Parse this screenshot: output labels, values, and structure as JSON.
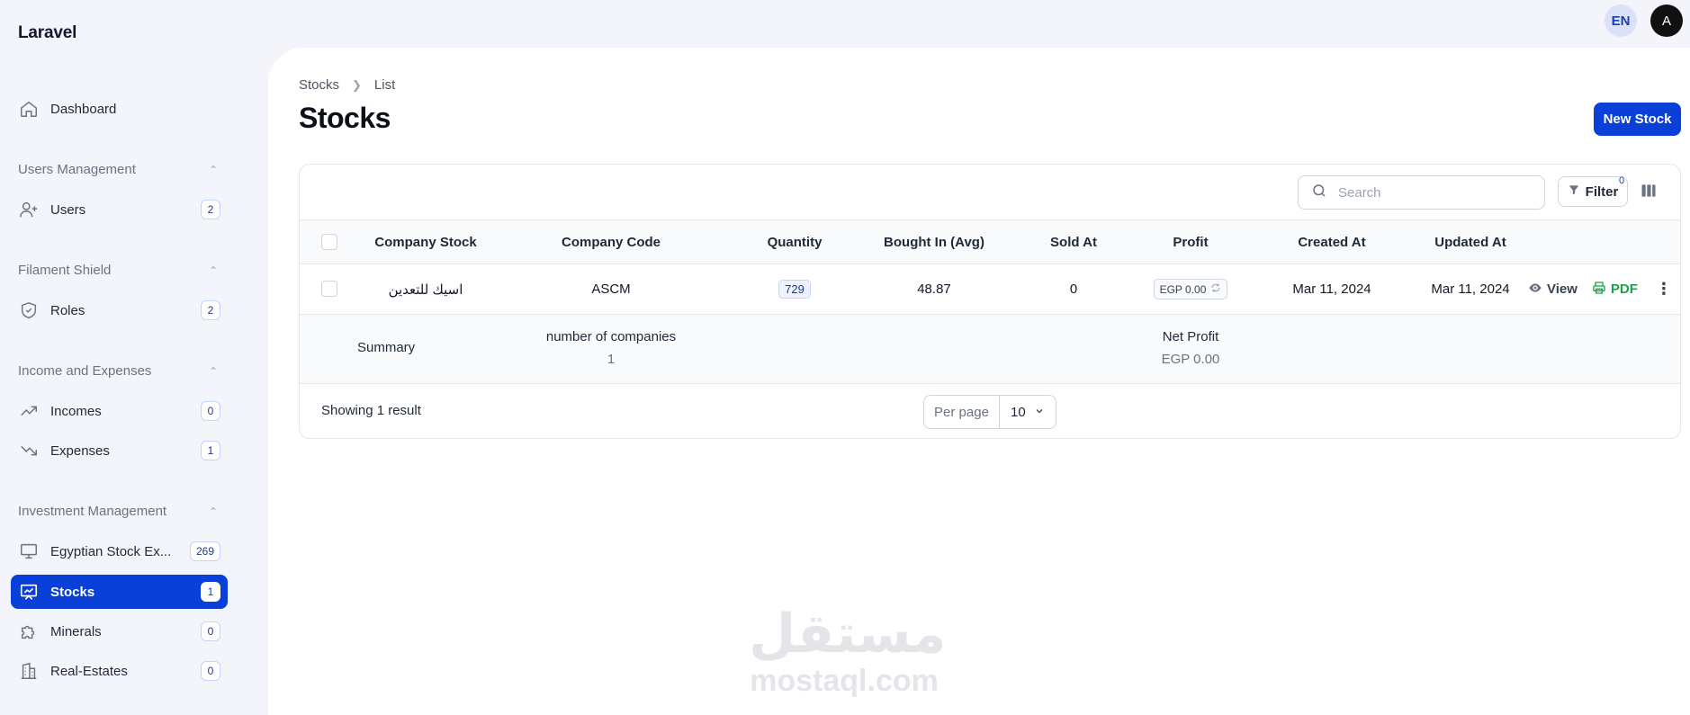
{
  "brand": "Laravel",
  "topbar": {
    "lang": "EN",
    "user_initial": "A"
  },
  "sidebar": {
    "dashboard": "Dashboard",
    "groups": [
      {
        "title": "Users Management",
        "items": [
          {
            "label": "Users",
            "count": "2"
          }
        ]
      },
      {
        "title": "Filament Shield",
        "items": [
          {
            "label": "Roles",
            "count": "2"
          }
        ]
      },
      {
        "title": "Income and Expenses",
        "items": [
          {
            "label": "Incomes",
            "count": "0"
          },
          {
            "label": "Expenses",
            "count": "1"
          }
        ]
      },
      {
        "title": "Investment Management",
        "items": [
          {
            "label": "Egyptian Stock Ex...",
            "count": "269"
          },
          {
            "label": "Stocks",
            "count": "1"
          },
          {
            "label": "Minerals",
            "count": "0"
          },
          {
            "label": "Real-Estates",
            "count": "0"
          }
        ]
      }
    ]
  },
  "breadcrumb": {
    "parent": "Stocks",
    "current": "List"
  },
  "page": {
    "title": "Stocks",
    "new_button": "New Stock"
  },
  "toolbar": {
    "search_placeholder": "Search",
    "filter_label": "Filter",
    "filter_count": "0"
  },
  "table": {
    "columns": {
      "company_stock": "Company Stock",
      "company_code": "Company Code",
      "quantity": "Quantity",
      "bought_in": "Bought In (Avg)",
      "sold_at": "Sold At",
      "profit": "Profit",
      "created_at": "Created At",
      "updated_at": "Updated At"
    },
    "rows": [
      {
        "company_stock": "اسيك للتعدين",
        "company_code": "ASCM",
        "quantity": "729",
        "bought_in": "48.87",
        "sold_at": "0",
        "profit": "EGP 0.00",
        "created_at": "Mar 11, 2024",
        "updated_at": "Mar 11, 2024",
        "view": "View",
        "pdf": "PDF"
      }
    ],
    "summary": {
      "label": "Summary",
      "companies_label": "number of companies",
      "companies_value": "1",
      "net_profit_label": "Net Profit",
      "net_profit_value": "EGP 0.00"
    }
  },
  "pagination": {
    "showing": "Showing 1 result",
    "per_page_label": "Per page",
    "per_page_value": "10"
  },
  "watermark": {
    "arabic": "مستقل",
    "latin": "mostaql.com"
  },
  "colors": {
    "primary": "#0a3fd8",
    "pdf": "#16a34a",
    "sidebar_bg": "#f3f5fb"
  }
}
